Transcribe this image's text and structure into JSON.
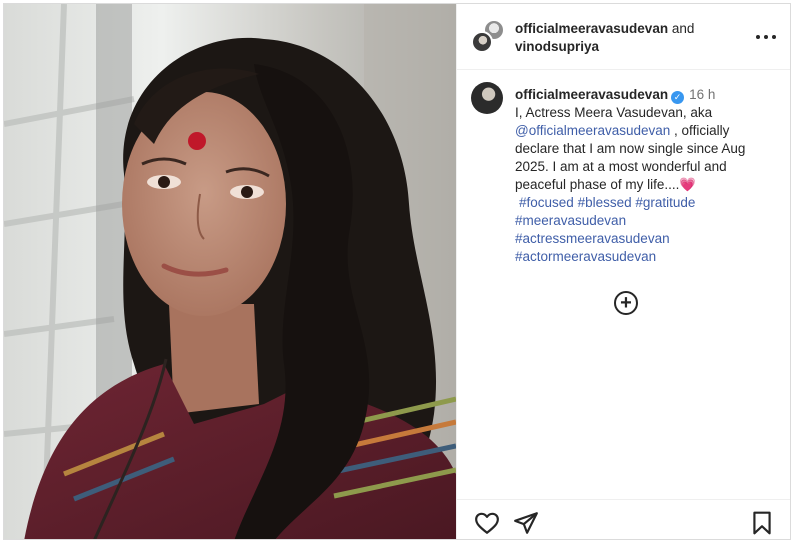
{
  "header": {
    "user1": "officialmeeravasudevan",
    "conjunction": "and",
    "user2": "vinodsupriya"
  },
  "caption": {
    "username": "officialmeeravasudevan",
    "verified_icon": "verified-badge-icon",
    "time": "16 h",
    "line1": "I, Actress Meera Vasudevan, aka",
    "mention": "@officialmeeravasudevan",
    "text2": " , officially declare that I am now single since Aug 2025. I am at a most wonderful and peaceful phase of my life....",
    "emoji": "💗",
    "hashtags": [
      "#focused",
      "#blessed",
      "#gratitude",
      "#meeravasudevan",
      "#actressmeeravasudevan",
      "#actormeeravasudevan"
    ]
  },
  "icons": {
    "more": "more-options-icon",
    "add_comment": "add-comment-icon",
    "like": "heart-icon",
    "share": "share-icon",
    "save": "bookmark-icon"
  },
  "colors": {
    "link": "#3f5ea8",
    "verified": "#3897f0",
    "border": "#dbdbdb"
  }
}
